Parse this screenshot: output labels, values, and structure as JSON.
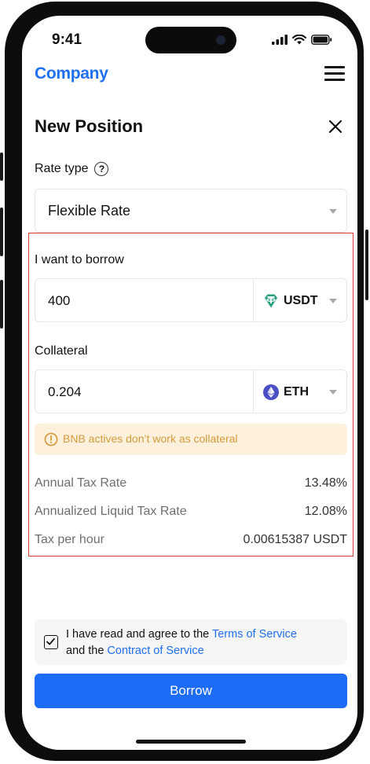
{
  "status_bar": {
    "time": "9:41"
  },
  "header": {
    "brand": "Company"
  },
  "page": {
    "title": "New Position"
  },
  "rate_type": {
    "label": "Rate type",
    "selected": "Flexible Rate"
  },
  "borrow": {
    "label": "I want to borrow",
    "amount": "400",
    "token": "USDT"
  },
  "collateral": {
    "label": "Collateral",
    "amount": "0.204",
    "token": "ETH"
  },
  "warning": {
    "text": "BNB actives don’t work as collateral"
  },
  "rates": [
    {
      "label": "Annual Tax Rate",
      "value": "13.48%"
    },
    {
      "label": "Annualized Liquid Tax Rate",
      "value": "12.08%"
    },
    {
      "label": "Tax per hour",
      "value": "0.00615387 USDT"
    }
  ],
  "agreement": {
    "checked": true,
    "prefix": "I have read and agree to the ",
    "terms_link": "Terms of Service",
    "middle": "and the ",
    "contract_link": "Contract of Service"
  },
  "actions": {
    "borrow_label": "Borrow"
  },
  "colors": {
    "accent": "#1d6cf5",
    "brand": "#1e6ff1",
    "highlight": "#e03a2f",
    "warning_bg": "#fdf0dc",
    "warning_text": "#d49b3a",
    "usdt": "#26a17b",
    "eth": "#4b4fc4"
  }
}
